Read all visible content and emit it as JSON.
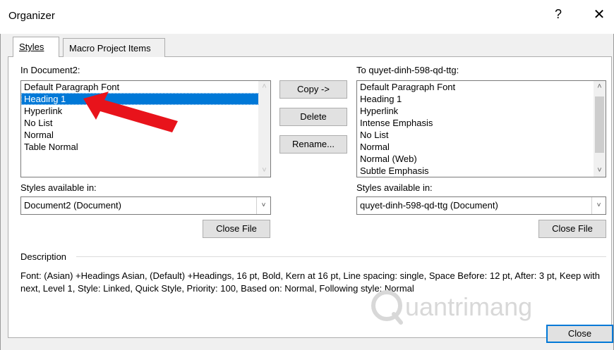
{
  "window": {
    "title": "Organizer",
    "help_glyph": "?",
    "close_glyph": "✕"
  },
  "tabs": [
    {
      "label": "Styles",
      "active": true
    },
    {
      "label": "Macro Project Items",
      "active": false
    }
  ],
  "left": {
    "list_label": "In Document2:",
    "items": [
      "Default Paragraph Font",
      "Heading 1",
      "Hyperlink",
      "No List",
      "Normal",
      "Table Normal"
    ],
    "selected_index": 1,
    "available_label": "Styles available in:",
    "available_value": "Document2 (Document)",
    "close_file_label": "Close File"
  },
  "middle": {
    "copy_label": "Copy ->",
    "delete_label": "Delete",
    "rename_label": "Rename..."
  },
  "right": {
    "list_label": "To quyet-dinh-598-qd-ttg:",
    "items": [
      "Default Paragraph Font",
      "Heading 1",
      "Hyperlink",
      "Intense Emphasis",
      "No List",
      "Normal",
      "Normal (Web)",
      "Subtle Emphasis"
    ],
    "available_label": "Styles available in:",
    "available_value": "quyet-dinh-598-qd-ttg (Document)",
    "close_file_label": "Close File"
  },
  "description": {
    "heading": "Description",
    "text": "Font: (Asian) +Headings Asian, (Default) +Headings, 16 pt, Bold, Kern at 16 pt, Line spacing:  single, Space Before:  12 pt, After:  3 pt, Keep with next, Level 1, Style: Linked, Quick Style, Priority: 100, Based on: Normal, Following style: Normal"
  },
  "footer": {
    "close_label": "Close"
  },
  "watermark": {
    "text": "uantrimang"
  },
  "colors": {
    "selection": "#0078d7",
    "arrow": "#e8131b"
  }
}
